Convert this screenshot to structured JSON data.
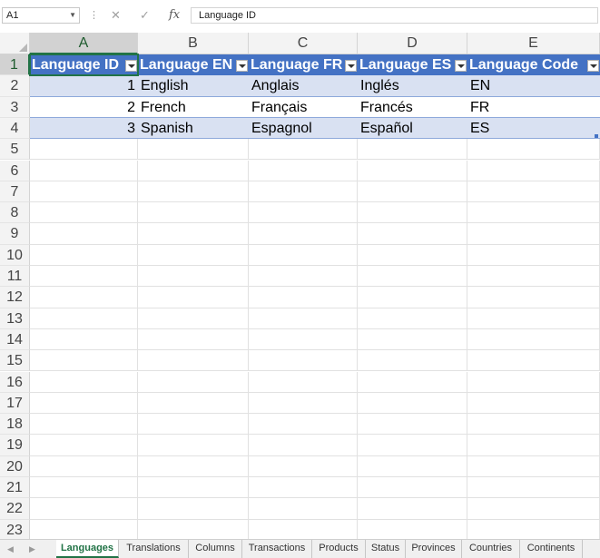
{
  "formula_bar": {
    "name_box": "A1",
    "cancel_icon": "✕",
    "enter_icon": "✓",
    "fx_label": "fx",
    "content": "Language ID"
  },
  "columns": [
    "A",
    "B",
    "C",
    "D",
    "E"
  ],
  "rows": [
    "1",
    "2",
    "3",
    "4",
    "5",
    "6",
    "7",
    "8",
    "9",
    "10",
    "11",
    "12",
    "13",
    "14",
    "15",
    "16",
    "17",
    "18",
    "19",
    "20",
    "21",
    "22",
    "23"
  ],
  "table": {
    "headers": [
      "Language ID",
      "Language EN",
      "Language FR",
      "Language ES",
      "Language Code"
    ],
    "data": [
      [
        "1",
        "English",
        "Anglais",
        "Inglés",
        "EN"
      ],
      [
        "2",
        "French",
        "Français",
        "Francés",
        "FR"
      ],
      [
        "3",
        "Spanish",
        "Espagnol",
        "Español",
        "ES"
      ]
    ]
  },
  "sheet_tabs": [
    "Languages",
    "Translations",
    "Columns",
    "Transactions",
    "Products",
    "Status",
    "Provinces",
    "Countries",
    "Continents"
  ],
  "active_tab": "Languages",
  "colors": {
    "table_header": "#4472c4",
    "band": "#d9e1f2",
    "accent": "#217346"
  }
}
